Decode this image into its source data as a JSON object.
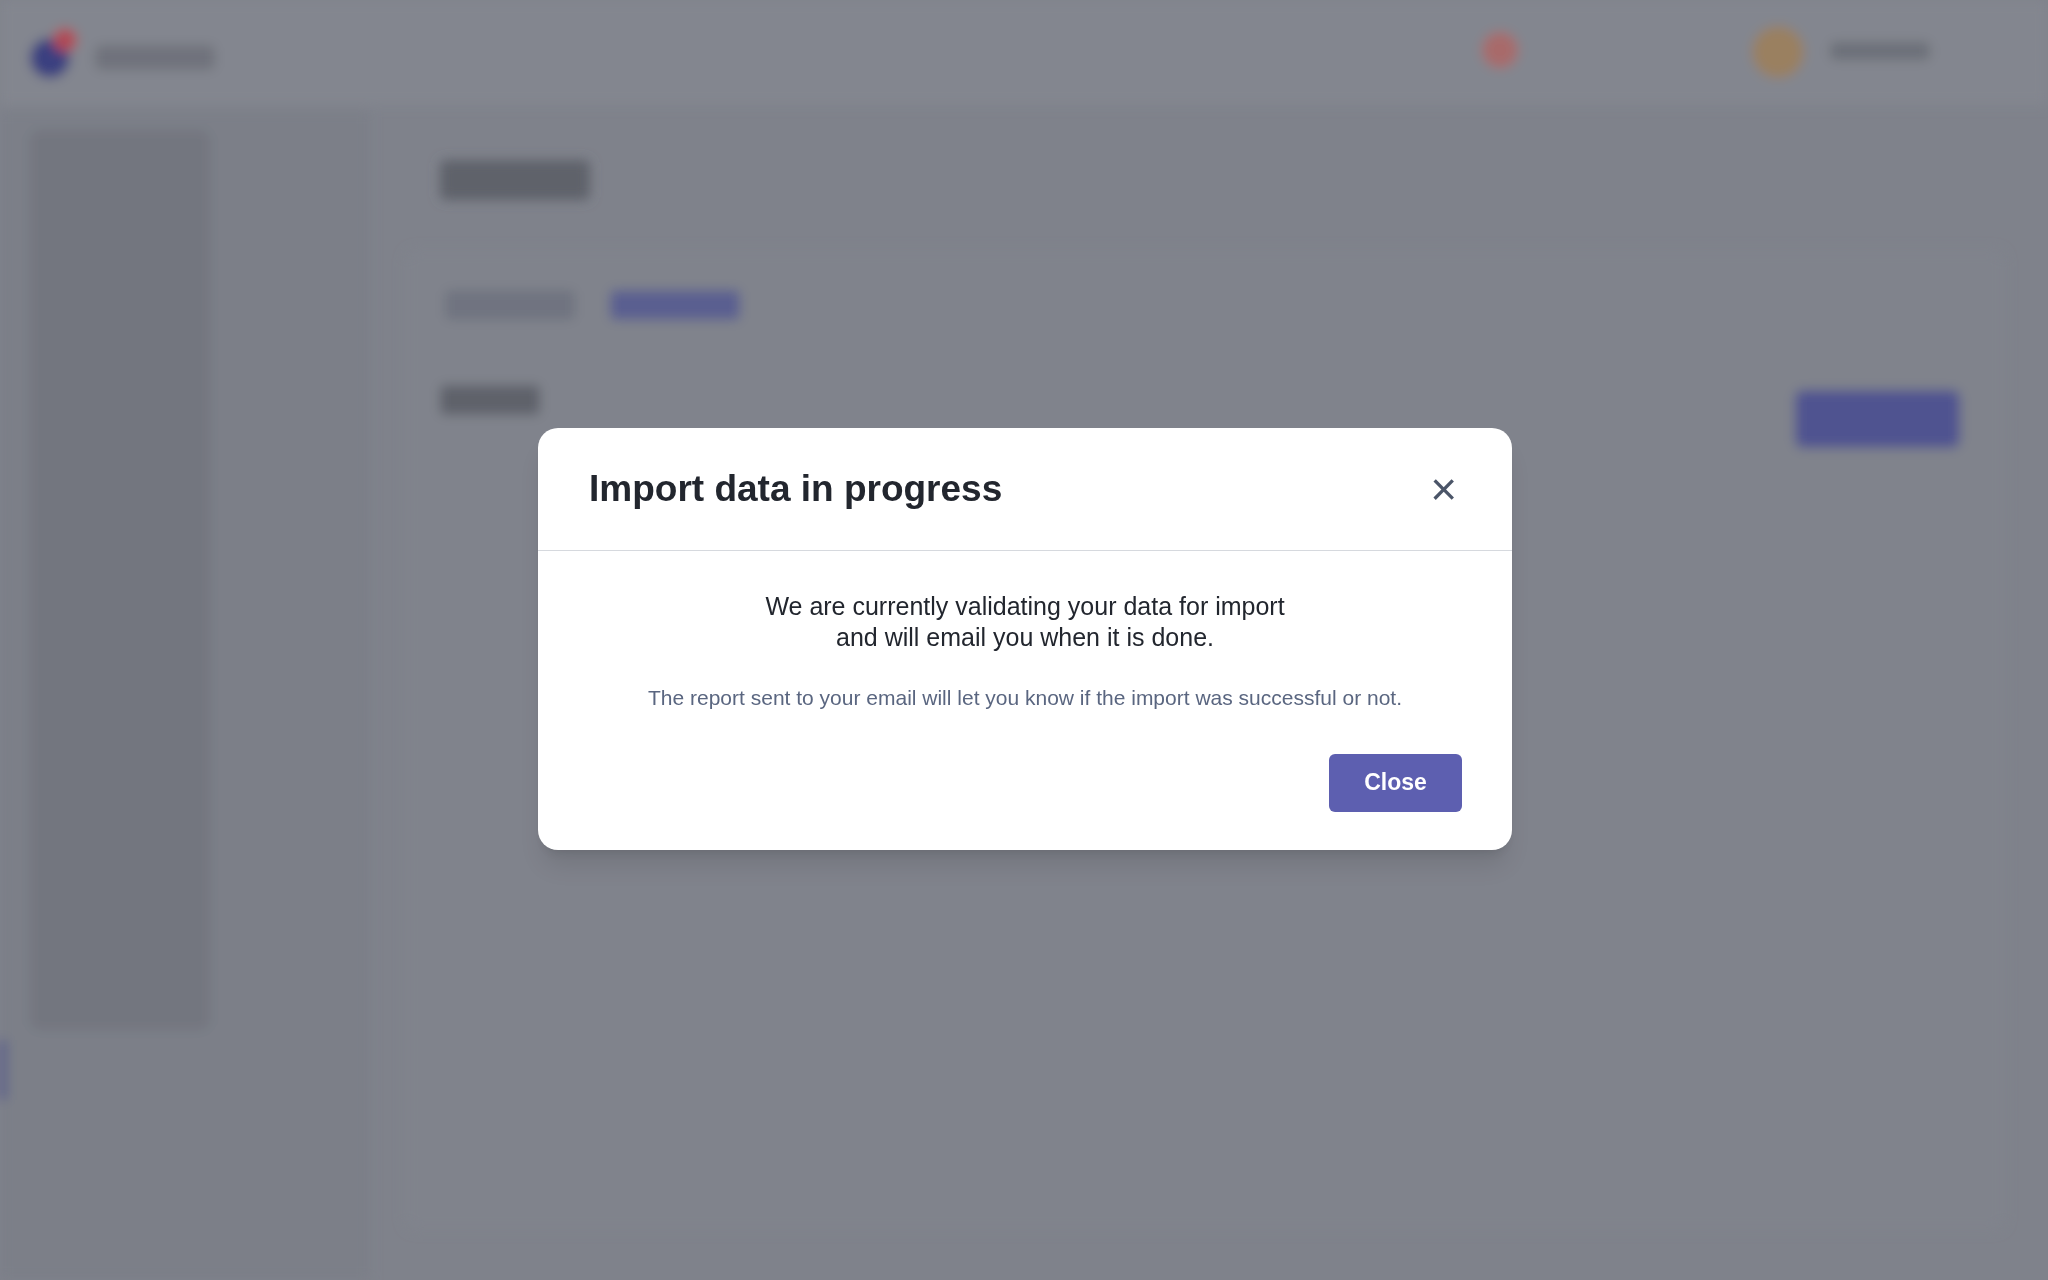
{
  "dialog": {
    "title": "Import data in progress",
    "close_icon": "×",
    "message": "We are currently validating your data for import and will email you when it is done.",
    "note": "The report sent to your email will let you know if the import was successful or not.",
    "buttons": [
      "Close"
    ]
  }
}
